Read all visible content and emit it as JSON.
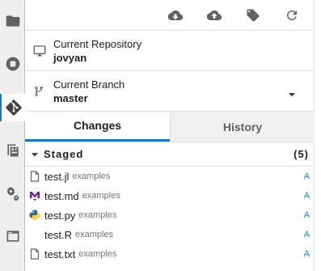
{
  "activity_bar": {
    "items": [
      {
        "name": "file-browser",
        "icon": "folder-icon"
      },
      {
        "name": "running",
        "icon": "stop-circle-icon"
      },
      {
        "name": "git",
        "icon": "git-icon",
        "active": true
      },
      {
        "name": "commands",
        "icon": "palette-icon"
      },
      {
        "name": "property-inspector",
        "icon": "gears-icon"
      },
      {
        "name": "tabs",
        "icon": "tab-icon"
      }
    ]
  },
  "toolbar": {
    "buttons": [
      {
        "name": "pull",
        "icon": "cloud-download-icon"
      },
      {
        "name": "push",
        "icon": "cloud-upload-icon"
      },
      {
        "name": "tag",
        "icon": "tag-icon"
      },
      {
        "name": "refresh",
        "icon": "refresh-icon"
      }
    ]
  },
  "repository": {
    "label": "Current Repository",
    "value": "jovyan"
  },
  "branch": {
    "label": "Current Branch",
    "value": "master"
  },
  "tabs": {
    "changes": "Changes",
    "history": "History",
    "active": "changes"
  },
  "staged": {
    "title": "Staged",
    "count": "(5)",
    "files": [
      {
        "name": "test.jl",
        "path": "examples",
        "status": "A",
        "icon": "file-icon"
      },
      {
        "name": "test.md",
        "path": "examples",
        "status": "A",
        "icon": "markdown-icon"
      },
      {
        "name": "test.py",
        "path": "examples",
        "status": "A",
        "icon": "python-icon"
      },
      {
        "name": "test.R",
        "path": "examples",
        "status": "A",
        "icon": "none"
      },
      {
        "name": "test.txt",
        "path": "examples",
        "status": "A",
        "icon": "file-icon"
      }
    ]
  },
  "colors": {
    "accent": "#1976d2",
    "status_added": "#1e88e5",
    "markdown": "#7b1fa2",
    "python_blue": "#306998",
    "python_yellow": "#ffd43b"
  }
}
